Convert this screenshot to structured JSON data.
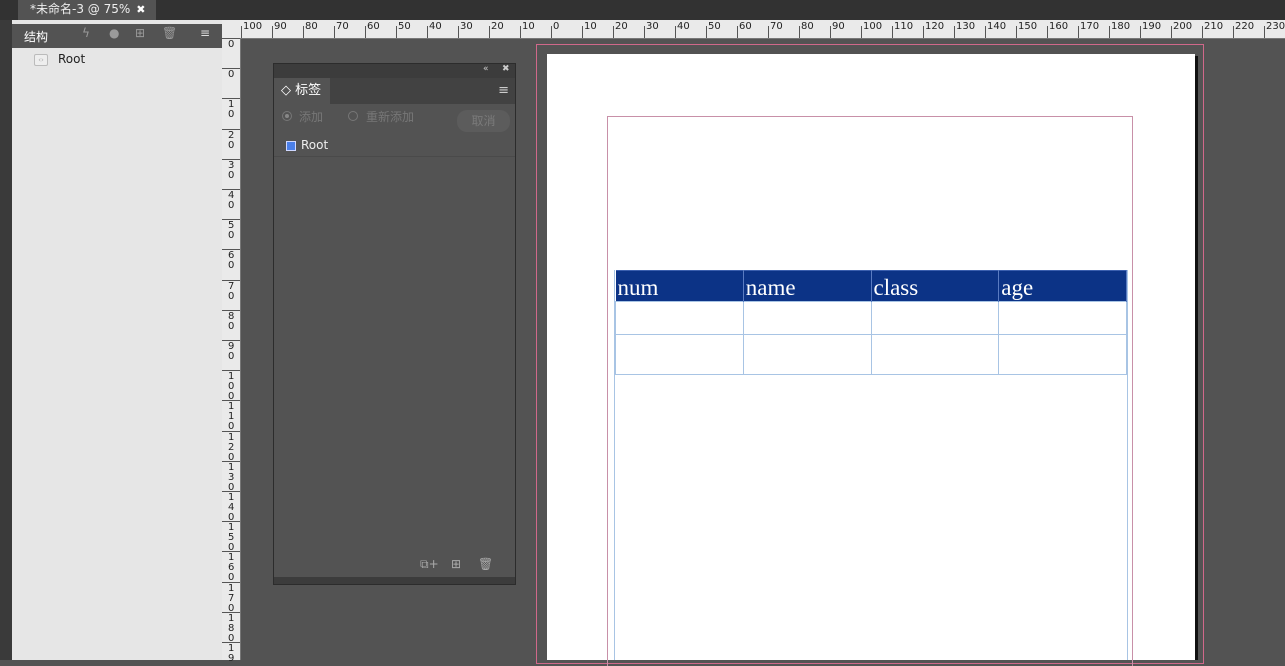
{
  "document": {
    "tab_title": "*未命名-3 @ 75%",
    "close_glyph": "✖"
  },
  "structure_panel": {
    "title": "结构",
    "icons": [
      "lightning-icon",
      "dot-icon",
      "plus-box-icon",
      "trash-icon",
      "menu-icon"
    ],
    "root_label": "Root"
  },
  "rulers": {
    "horizontal_labels": [
      "100",
      "90",
      "80",
      "70",
      "60",
      "50",
      "40",
      "30",
      "20",
      "10",
      "0",
      "10",
      "20",
      "30",
      "40",
      "50",
      "60",
      "70",
      "80",
      "90",
      "100",
      "110",
      "120",
      "130",
      "140",
      "150",
      "160",
      "170",
      "180",
      "190",
      "200",
      "210",
      "220",
      "230"
    ],
    "vertical_labels": [
      "0",
      "0",
      "10",
      "20",
      "30",
      "40",
      "50",
      "60",
      "70",
      "80",
      "90",
      "100",
      "110",
      "120",
      "130",
      "140",
      "150",
      "160",
      "170",
      "180",
      "19"
    ]
  },
  "tags_panel": {
    "tab_label": "◇ 标签",
    "collapse_glyph": "«",
    "close_glyph": "✖",
    "menu_glyph": "≡",
    "add_label": "添加",
    "readd_label": "重新添加",
    "cancel_label": "取消",
    "root_label": "Root",
    "root_color": "#4a7fe8"
  },
  "table": {
    "headers": [
      "num",
      "name",
      "class",
      "age"
    ],
    "header_bg": "#0c3386",
    "rows": [
      [
        "",
        "",
        "",
        ""
      ],
      [
        "",
        "",
        "",
        ""
      ]
    ]
  }
}
